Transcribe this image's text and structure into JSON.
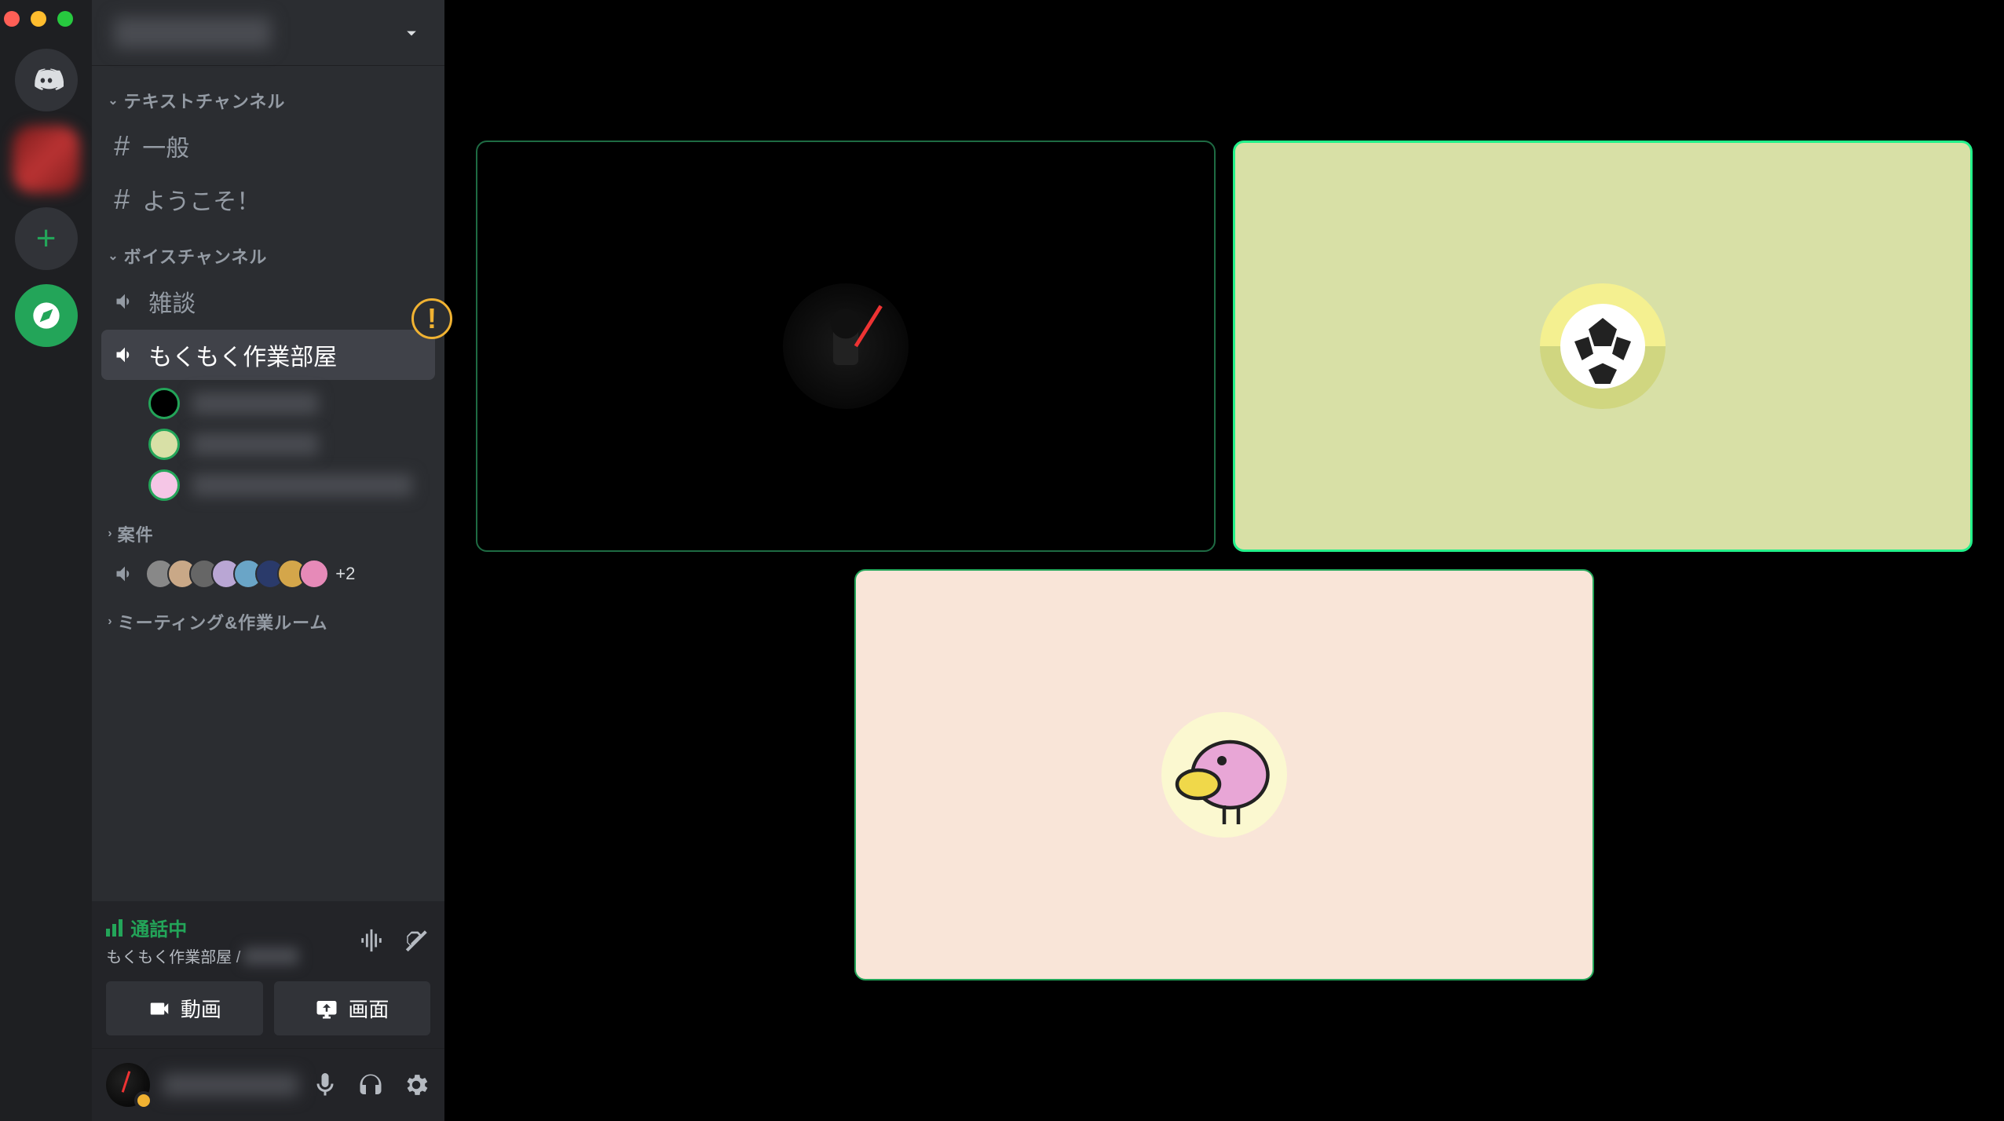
{
  "window": {
    "title": "Discord"
  },
  "server": {
    "name": "[サーバー名]"
  },
  "categories": [
    {
      "name": "テキストチャンネル",
      "channels": [
        {
          "type": "text",
          "name": "一般"
        },
        {
          "type": "text",
          "name": "ようこそ！"
        }
      ]
    },
    {
      "name": "ボイスチャンネル",
      "channels": [
        {
          "type": "voice",
          "name": "雑談"
        },
        {
          "type": "voice",
          "name": "もくもく作業部屋",
          "active": true,
          "users": [
            {
              "name": "[ユーザー1]",
              "avatar_bg": "#000"
            },
            {
              "name": "[ユーザー2]",
              "avatar_bg": "#d8e0a6"
            },
            {
              "name": "[ユーザー3]",
              "avatar_bg": "#f5c6e6"
            }
          ]
        }
      ]
    },
    {
      "name": "案件",
      "thumb_overflow": "+2",
      "thumb_count": 8
    },
    {
      "name": "ミーティング&作業ルーム"
    }
  ],
  "connection": {
    "status_label": "通話中",
    "channel_path": "もくもく作業部屋 / ",
    "video_button": "動画",
    "screen_button": "画面"
  },
  "user_panel": {
    "username": "[自分]"
  },
  "call": {
    "participants": [
      {
        "bg": "dark",
        "avatar": "vader"
      },
      {
        "bg": "green",
        "avatar": "soccer",
        "speaking": true
      },
      {
        "bg": "peach",
        "avatar": "bird"
      }
    ]
  },
  "colors": {
    "accent": "#23a559",
    "warning": "#f0b232"
  }
}
